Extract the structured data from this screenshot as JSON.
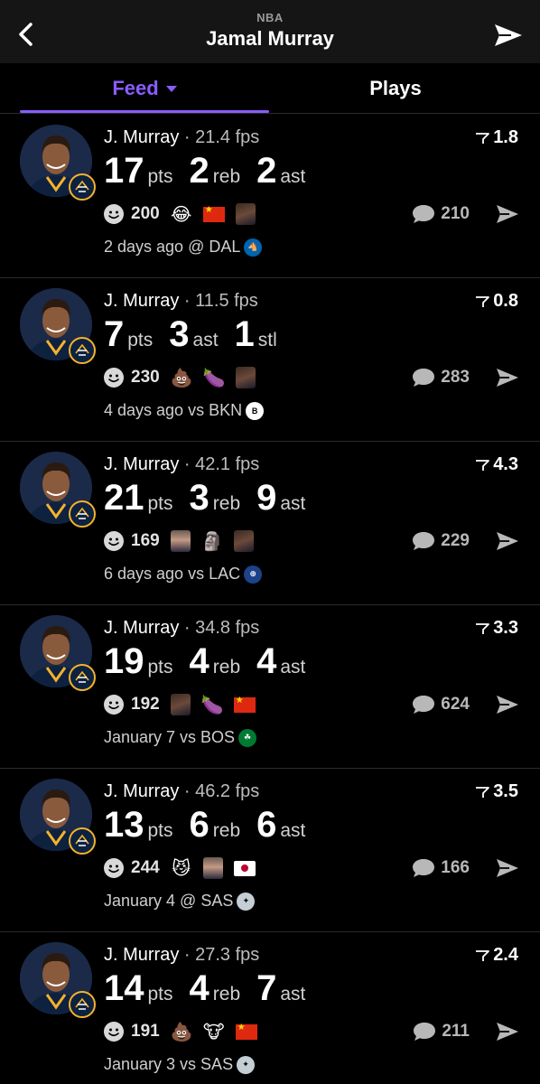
{
  "header": {
    "league": "NBA",
    "title": "Jamal Murray"
  },
  "tabs": {
    "feed": "Feed",
    "plays": "Plays"
  },
  "colors": {
    "accent": "#8a5cff",
    "card_border": "#2b2b2b",
    "topbar": "#151515"
  },
  "cards": [
    {
      "name": "J. Murray",
      "fps": "· 21.4 fps",
      "score": "1.8",
      "stats": [
        {
          "value": "17",
          "unit": "pts"
        },
        {
          "value": "2",
          "unit": "reb"
        },
        {
          "value": "2",
          "unit": "ast"
        }
      ],
      "reaction_count": "200",
      "reactions": [
        "😂",
        "china-flag",
        "player-photo"
      ],
      "comments": "210",
      "when": "2 days ago @ DAL",
      "team_icon": "mavericks-logo"
    },
    {
      "name": "J. Murray",
      "fps": "· 11.5 fps",
      "score": "0.8",
      "stats": [
        {
          "value": "7",
          "unit": "pts"
        },
        {
          "value": "3",
          "unit": "ast"
        },
        {
          "value": "1",
          "unit": "stl"
        }
      ],
      "reaction_count": "230",
      "reactions": [
        "💩",
        "🍆",
        "player-photo"
      ],
      "comments": "283",
      "when": "4 days ago vs BKN",
      "team_icon": "nets-logo"
    },
    {
      "name": "J. Murray",
      "fps": "· 42.1 fps",
      "score": "4.3",
      "stats": [
        {
          "value": "21",
          "unit": "pts"
        },
        {
          "value": "3",
          "unit": "reb"
        },
        {
          "value": "9",
          "unit": "ast"
        }
      ],
      "reaction_count": "169",
      "reactions": [
        "person-photo",
        "🗿",
        "player-photo"
      ],
      "comments": "229",
      "when": "6 days ago vs LAC",
      "team_icon": "clippers-logo"
    },
    {
      "name": "J. Murray",
      "fps": "· 34.8 fps",
      "score": "3.3",
      "stats": [
        {
          "value": "19",
          "unit": "pts"
        },
        {
          "value": "4",
          "unit": "reb"
        },
        {
          "value": "4",
          "unit": "ast"
        }
      ],
      "reaction_count": "192",
      "reactions": [
        "player-photo",
        "🍆",
        "china-flag"
      ],
      "comments": "624",
      "when": "January 7 vs BOS",
      "team_icon": "celtics-logo"
    },
    {
      "name": "J. Murray",
      "fps": "· 46.2 fps",
      "score": "3.5",
      "stats": [
        {
          "value": "13",
          "unit": "pts"
        },
        {
          "value": "6",
          "unit": "reb"
        },
        {
          "value": "6",
          "unit": "ast"
        }
      ],
      "reaction_count": "244",
      "reactions": [
        "😼",
        "person-photo",
        "japan-flag"
      ],
      "comments": "166",
      "when": "January 4 @ SAS",
      "team_icon": "spurs-logo"
    },
    {
      "name": "J. Murray",
      "fps": "· 27.3 fps",
      "score": "2.4",
      "stats": [
        {
          "value": "14",
          "unit": "pts"
        },
        {
          "value": "4",
          "unit": "reb"
        },
        {
          "value": "7",
          "unit": "ast"
        }
      ],
      "reaction_count": "191",
      "reactions": [
        "💩",
        "🐮",
        "china-flag"
      ],
      "comments": "211",
      "when": "January 3 vs SAS",
      "team_icon": "spurs-logo"
    }
  ]
}
